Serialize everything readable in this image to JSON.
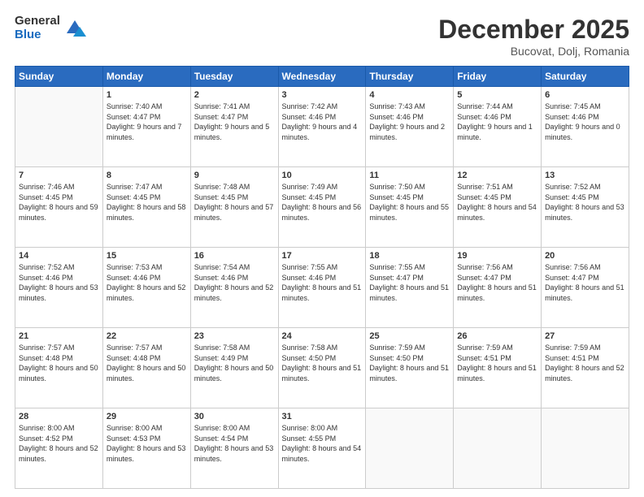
{
  "logo": {
    "general": "General",
    "blue": "Blue"
  },
  "header": {
    "month": "December 2025",
    "location": "Bucovat, Dolj, Romania"
  },
  "weekdays": [
    "Sunday",
    "Monday",
    "Tuesday",
    "Wednesday",
    "Thursday",
    "Friday",
    "Saturday"
  ],
  "days": {
    "d1": {
      "num": "1",
      "sunrise": "7:40 AM",
      "sunset": "4:47 PM",
      "daylight": "9 hours and 7 minutes."
    },
    "d2": {
      "num": "2",
      "sunrise": "7:41 AM",
      "sunset": "4:47 PM",
      "daylight": "9 hours and 5 minutes."
    },
    "d3": {
      "num": "3",
      "sunrise": "7:42 AM",
      "sunset": "4:46 PM",
      "daylight": "9 hours and 4 minutes."
    },
    "d4": {
      "num": "4",
      "sunrise": "7:43 AM",
      "sunset": "4:46 PM",
      "daylight": "9 hours and 2 minutes."
    },
    "d5": {
      "num": "5",
      "sunrise": "7:44 AM",
      "sunset": "4:46 PM",
      "daylight": "9 hours and 1 minute."
    },
    "d6": {
      "num": "6",
      "sunrise": "7:45 AM",
      "sunset": "4:46 PM",
      "daylight": "9 hours and 0 minutes."
    },
    "d7": {
      "num": "7",
      "sunrise": "7:46 AM",
      "sunset": "4:45 PM",
      "daylight": "8 hours and 59 minutes."
    },
    "d8": {
      "num": "8",
      "sunrise": "7:47 AM",
      "sunset": "4:45 PM",
      "daylight": "8 hours and 58 minutes."
    },
    "d9": {
      "num": "9",
      "sunrise": "7:48 AM",
      "sunset": "4:45 PM",
      "daylight": "8 hours and 57 minutes."
    },
    "d10": {
      "num": "10",
      "sunrise": "7:49 AM",
      "sunset": "4:45 PM",
      "daylight": "8 hours and 56 minutes."
    },
    "d11": {
      "num": "11",
      "sunrise": "7:50 AM",
      "sunset": "4:45 PM",
      "daylight": "8 hours and 55 minutes."
    },
    "d12": {
      "num": "12",
      "sunrise": "7:51 AM",
      "sunset": "4:45 PM",
      "daylight": "8 hours and 54 minutes."
    },
    "d13": {
      "num": "13",
      "sunrise": "7:52 AM",
      "sunset": "4:45 PM",
      "daylight": "8 hours and 53 minutes."
    },
    "d14": {
      "num": "14",
      "sunrise": "7:52 AM",
      "sunset": "4:46 PM",
      "daylight": "8 hours and 53 minutes."
    },
    "d15": {
      "num": "15",
      "sunrise": "7:53 AM",
      "sunset": "4:46 PM",
      "daylight": "8 hours and 52 minutes."
    },
    "d16": {
      "num": "16",
      "sunrise": "7:54 AM",
      "sunset": "4:46 PM",
      "daylight": "8 hours and 52 minutes."
    },
    "d17": {
      "num": "17",
      "sunrise": "7:55 AM",
      "sunset": "4:46 PM",
      "daylight": "8 hours and 51 minutes."
    },
    "d18": {
      "num": "18",
      "sunrise": "7:55 AM",
      "sunset": "4:47 PM",
      "daylight": "8 hours and 51 minutes."
    },
    "d19": {
      "num": "19",
      "sunrise": "7:56 AM",
      "sunset": "4:47 PM",
      "daylight": "8 hours and 51 minutes."
    },
    "d20": {
      "num": "20",
      "sunrise": "7:56 AM",
      "sunset": "4:47 PM",
      "daylight": "8 hours and 51 minutes."
    },
    "d21": {
      "num": "21",
      "sunrise": "7:57 AM",
      "sunset": "4:48 PM",
      "daylight": "8 hours and 50 minutes."
    },
    "d22": {
      "num": "22",
      "sunrise": "7:57 AM",
      "sunset": "4:48 PM",
      "daylight": "8 hours and 50 minutes."
    },
    "d23": {
      "num": "23",
      "sunrise": "7:58 AM",
      "sunset": "4:49 PM",
      "daylight": "8 hours and 50 minutes."
    },
    "d24": {
      "num": "24",
      "sunrise": "7:58 AM",
      "sunset": "4:50 PM",
      "daylight": "8 hours and 51 minutes."
    },
    "d25": {
      "num": "25",
      "sunrise": "7:59 AM",
      "sunset": "4:50 PM",
      "daylight": "8 hours and 51 minutes."
    },
    "d26": {
      "num": "26",
      "sunrise": "7:59 AM",
      "sunset": "4:51 PM",
      "daylight": "8 hours and 51 minutes."
    },
    "d27": {
      "num": "27",
      "sunrise": "7:59 AM",
      "sunset": "4:51 PM",
      "daylight": "8 hours and 52 minutes."
    },
    "d28": {
      "num": "28",
      "sunrise": "8:00 AM",
      "sunset": "4:52 PM",
      "daylight": "8 hours and 52 minutes."
    },
    "d29": {
      "num": "29",
      "sunrise": "8:00 AM",
      "sunset": "4:53 PM",
      "daylight": "8 hours and 53 minutes."
    },
    "d30": {
      "num": "30",
      "sunrise": "8:00 AM",
      "sunset": "4:54 PM",
      "daylight": "8 hours and 53 minutes."
    },
    "d31": {
      "num": "31",
      "sunrise": "8:00 AM",
      "sunset": "4:55 PM",
      "daylight": "8 hours and 54 minutes."
    }
  },
  "labels": {
    "sunrise": "Sunrise:",
    "sunset": "Sunset:",
    "daylight": "Daylight:"
  }
}
